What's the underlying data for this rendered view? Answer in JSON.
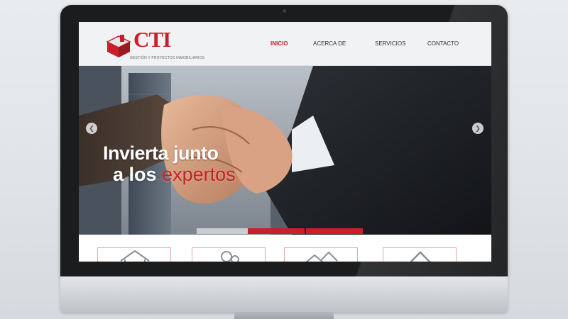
{
  "brand": {
    "name": "CTI",
    "tagline": "GESTIÓN Y PROYECTOS INMOBILIARIOS",
    "color": "#c8202a"
  },
  "nav": [
    {
      "label": "INICIO",
      "active": true
    },
    {
      "label": "ACERCA DE",
      "active": false
    },
    {
      "label": "SERVICIOS",
      "active": false
    },
    {
      "label": "CONTACTO",
      "active": false
    }
  ],
  "hero": {
    "line1": "Invierta junto",
    "line2_lead": "a los",
    "line2_accent": "expertos",
    "prev_icon": "chevron-left-icon",
    "next_icon": "chevron-right-icon",
    "prev_glyph": "❮",
    "next_glyph": "❯"
  },
  "features": [
    {
      "icon": "house-icon"
    },
    {
      "icon": "people-icon"
    },
    {
      "icon": "buildings-icon"
    },
    {
      "icon": "roof-icon"
    }
  ]
}
